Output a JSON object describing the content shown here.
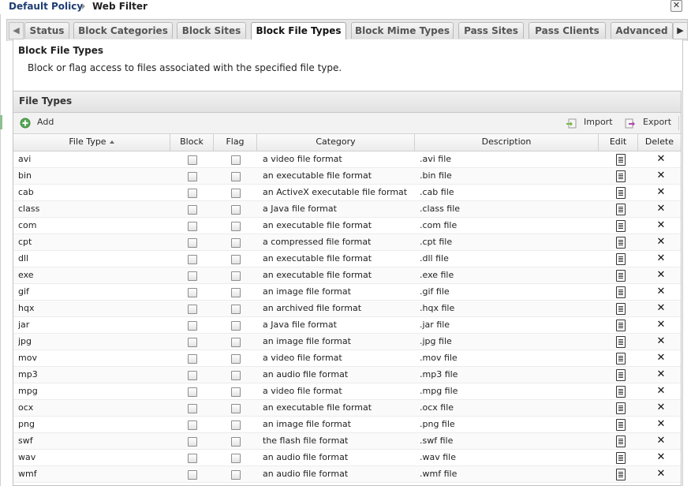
{
  "breadcrumb": {
    "policy": "Default Policy",
    "current": "Web Filter"
  },
  "window": {
    "close_icon": "close-icon"
  },
  "tabs": [
    {
      "label": "Status",
      "active": false
    },
    {
      "label": "Block Categories",
      "active": false
    },
    {
      "label": "Block Sites",
      "active": false
    },
    {
      "label": "Block File Types",
      "active": true
    },
    {
      "label": "Block Mime Types",
      "active": false
    },
    {
      "label": "Pass Sites",
      "active": false
    },
    {
      "label": "Pass Clients",
      "active": false
    },
    {
      "label": "Advanced",
      "active": false
    }
  ],
  "section": {
    "title": "Block File Types",
    "description": "Block or flag access to files associated with the specified file type."
  },
  "grid": {
    "title": "File Types",
    "toolbar": {
      "add_label": "Add",
      "import_label": "Import",
      "export_label": "Export"
    },
    "columns": {
      "file_type": "File Type",
      "block": "Block",
      "flag": "Flag",
      "category": "Category",
      "description": "Description",
      "edit": "Edit",
      "delete": "Delete"
    },
    "sort": {
      "column": "File Type",
      "direction": "ascending"
    },
    "rows": [
      {
        "type": "avi",
        "block": false,
        "flag": false,
        "category": "a video file format",
        "description": ".avi file"
      },
      {
        "type": "bin",
        "block": false,
        "flag": false,
        "category": "an executable file format",
        "description": ".bin file"
      },
      {
        "type": "cab",
        "block": false,
        "flag": false,
        "category": "an ActiveX executable file format",
        "description": ".cab file"
      },
      {
        "type": "class",
        "block": false,
        "flag": false,
        "category": "a Java file format",
        "description": ".class file"
      },
      {
        "type": "com",
        "block": false,
        "flag": false,
        "category": "an executable file format",
        "description": ".com file"
      },
      {
        "type": "cpt",
        "block": false,
        "flag": false,
        "category": "a compressed file format",
        "description": ".cpt file"
      },
      {
        "type": "dll",
        "block": false,
        "flag": false,
        "category": "an executable file format",
        "description": ".dll file"
      },
      {
        "type": "exe",
        "block": false,
        "flag": false,
        "category": "an executable file format",
        "description": ".exe file"
      },
      {
        "type": "gif",
        "block": false,
        "flag": false,
        "category": "an image file format",
        "description": ".gif file"
      },
      {
        "type": "hqx",
        "block": false,
        "flag": false,
        "category": "an archived file format",
        "description": ".hqx file"
      },
      {
        "type": "jar",
        "block": false,
        "flag": false,
        "category": "a Java file format",
        "description": ".jar file"
      },
      {
        "type": "jpg",
        "block": false,
        "flag": false,
        "category": "an image file format",
        "description": ".jpg file"
      },
      {
        "type": "mov",
        "block": false,
        "flag": false,
        "category": "a video file format",
        "description": ".mov file"
      },
      {
        "type": "mp3",
        "block": false,
        "flag": false,
        "category": "an audio file format",
        "description": ".mp3 file"
      },
      {
        "type": "mpg",
        "block": false,
        "flag": false,
        "category": "a video file format",
        "description": ".mpg file"
      },
      {
        "type": "ocx",
        "block": false,
        "flag": false,
        "category": "an executable file format",
        "description": ".ocx file"
      },
      {
        "type": "png",
        "block": false,
        "flag": false,
        "category": "an image file format",
        "description": ".png file"
      },
      {
        "type": "swf",
        "block": false,
        "flag": false,
        "category": "the flash file format",
        "description": ".swf file"
      },
      {
        "type": "wav",
        "block": false,
        "flag": false,
        "category": "an audio file format",
        "description": ".wav file"
      },
      {
        "type": "wmf",
        "block": false,
        "flag": false,
        "category": "an audio file format",
        "description": ".wmf file"
      }
    ]
  },
  "icons": {
    "add": "add-icon",
    "import": "import-icon",
    "export": "export-icon",
    "edit": "edit-icon",
    "delete": "delete-icon",
    "tab_scroll_left": "arrow-left-icon",
    "tab_scroll_right": "arrow-right-icon"
  },
  "colors": {
    "breadcrumb_link": "#1f3e73",
    "add_icon": "#5aa65a"
  }
}
